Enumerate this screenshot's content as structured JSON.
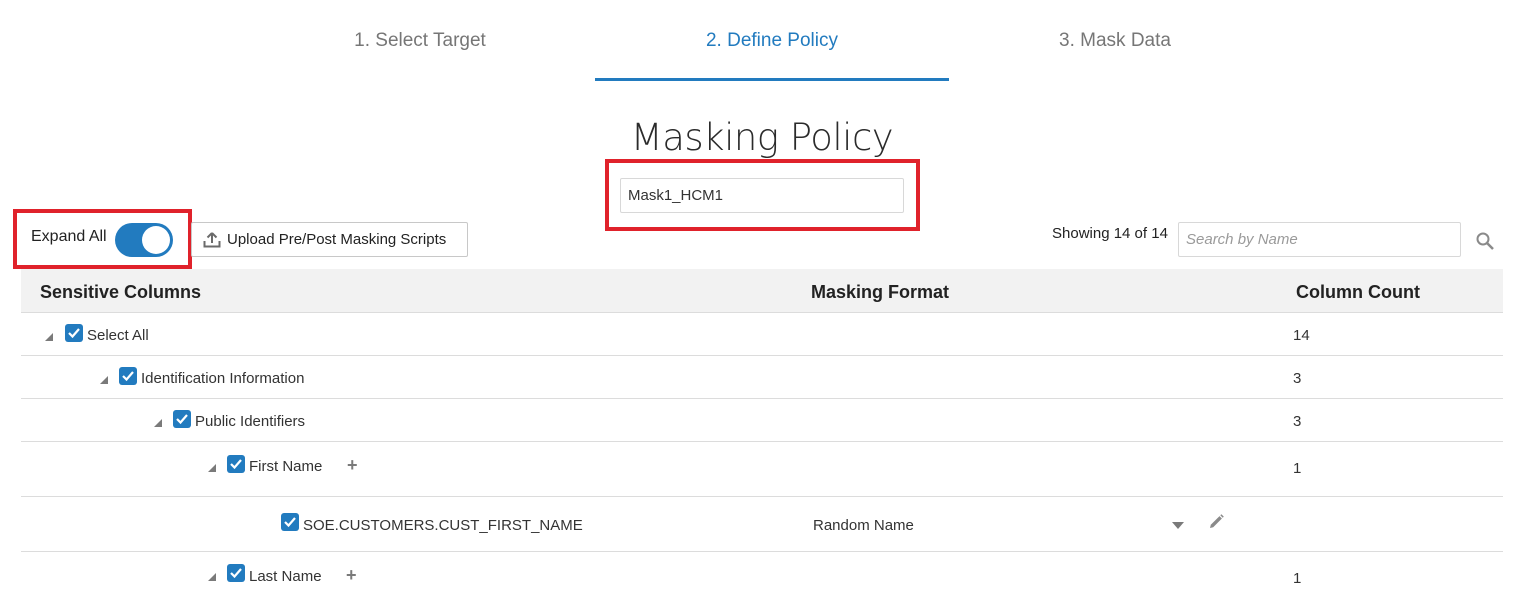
{
  "train": {
    "steps": [
      {
        "label": "1. Select Target"
      },
      {
        "label": "2. Define Policy"
      },
      {
        "label": "3. Mask Data"
      }
    ],
    "active_index": 1
  },
  "page_title": "Masking Policy",
  "policy_name": {
    "value": "Mask1_HCM1"
  },
  "toolbar": {
    "expand_all_label": "Expand All",
    "expand_all_on": true,
    "upload_label": "Upload Pre/Post Masking Scripts",
    "upload_icon": "upload-icon",
    "showing_text": "Showing 14 of 14",
    "search_placeholder": "Search by Name",
    "search_icon": "search-icon"
  },
  "table": {
    "headers": {
      "sensitive_columns": "Sensitive Columns",
      "masking_format": "Masking Format",
      "column_count": "Column Count"
    },
    "rows": [
      {
        "label": "Select All",
        "count": "14",
        "format": ""
      },
      {
        "label": "Identification Information",
        "count": "3",
        "format": ""
      },
      {
        "label": "Public Identifiers",
        "count": "3",
        "format": ""
      },
      {
        "label": "First Name",
        "count": "1",
        "format": ""
      },
      {
        "label": "SOE.CUSTOMERS.CUST_FIRST_NAME",
        "count": "",
        "format": "Random Name"
      },
      {
        "label": "Last Name",
        "count": "1",
        "format": ""
      }
    ]
  },
  "colors": {
    "accent": "#227bbf",
    "highlight_outline": "#e0222b"
  }
}
